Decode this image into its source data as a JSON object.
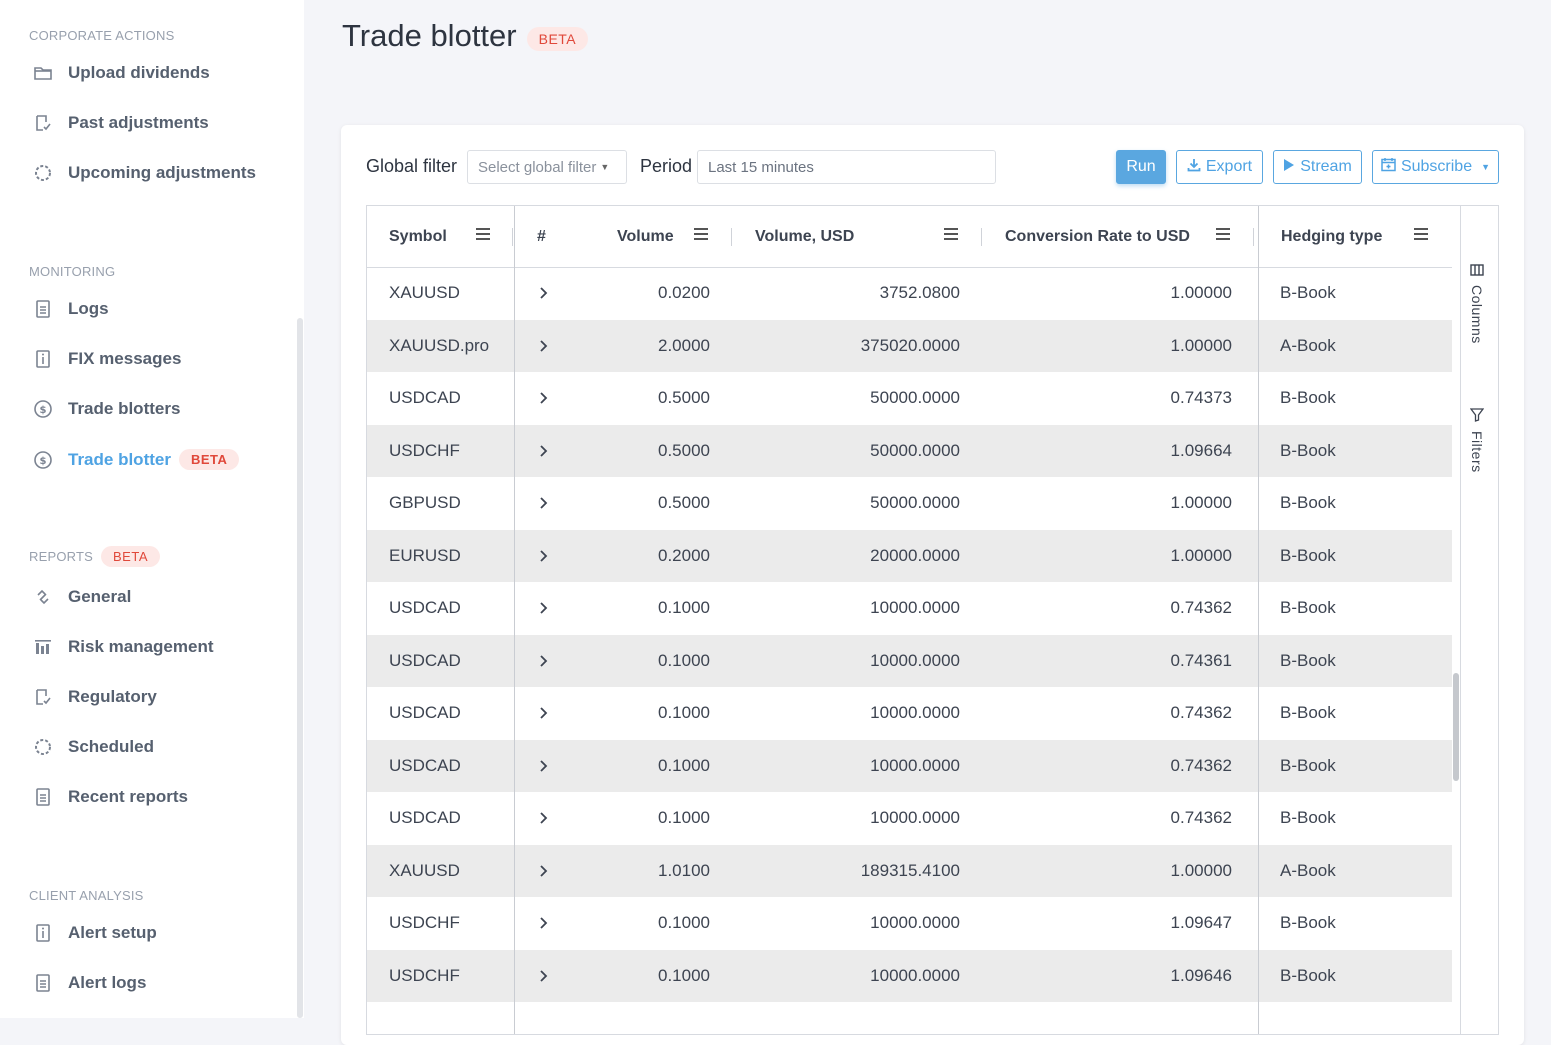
{
  "sidebar": {
    "sections": [
      {
        "title": "CORPORATE ACTIONS",
        "items": [
          {
            "label": "Upload dividends",
            "icon": "folder-icon"
          },
          {
            "label": "Past adjustments",
            "icon": "edit-check-icon"
          },
          {
            "label": "Upcoming adjustments",
            "icon": "loader-icon"
          }
        ]
      },
      {
        "title": "MONITORING",
        "items": [
          {
            "label": "Logs",
            "icon": "document-icon"
          },
          {
            "label": "FIX messages",
            "icon": "info-document-icon"
          },
          {
            "label": "Trade blotters",
            "icon": "dollar-circle-icon"
          },
          {
            "label": "Trade blotter",
            "icon": "dollar-circle-icon",
            "badge": "BETA",
            "active": true
          }
        ]
      },
      {
        "title": "REPORTS",
        "badge": "BETA",
        "items": [
          {
            "label": "General",
            "icon": "link-icon"
          },
          {
            "label": "Risk management",
            "icon": "bar-chart-icon"
          },
          {
            "label": "Regulatory",
            "icon": "edit-check-icon"
          },
          {
            "label": "Scheduled",
            "icon": "loader-icon"
          },
          {
            "label": "Recent reports",
            "icon": "document-icon"
          }
        ]
      },
      {
        "title": "CLIENT ANALYSIS",
        "items": [
          {
            "label": "Alert setup",
            "icon": "info-document-icon"
          },
          {
            "label": "Alert logs",
            "icon": "document-icon"
          }
        ]
      }
    ]
  },
  "page": {
    "title": "Trade blotter",
    "badge": "BETA"
  },
  "toolbar": {
    "global_filter_label": "Global filter",
    "global_filter_placeholder": "Select global filter",
    "period_label": "Period",
    "period_value": "Last 15 minutes",
    "run_label": "Run",
    "export_label": "Export",
    "stream_label": "Stream",
    "subscribe_label": "Subscribe"
  },
  "grid": {
    "columns": [
      "Symbol",
      "#",
      "Volume",
      "Volume, USD",
      "Conversion Rate to USD",
      "Hedging type"
    ],
    "side_tabs": [
      "Columns",
      "Filters"
    ],
    "rows": [
      {
        "symbol": "XAUUSD",
        "volume": "0.0200",
        "volume_usd": "3752.0800",
        "rate": "1.00000",
        "hedging": "B-Book"
      },
      {
        "symbol": "XAUUSD.pro",
        "volume": "2.0000",
        "volume_usd": "375020.0000",
        "rate": "1.00000",
        "hedging": "A-Book"
      },
      {
        "symbol": "USDCAD",
        "volume": "0.5000",
        "volume_usd": "50000.0000",
        "rate": "0.74373",
        "hedging": "B-Book"
      },
      {
        "symbol": "USDCHF",
        "volume": "0.5000",
        "volume_usd": "50000.0000",
        "rate": "1.09664",
        "hedging": "B-Book"
      },
      {
        "symbol": "GBPUSD",
        "volume": "0.5000",
        "volume_usd": "50000.0000",
        "rate": "1.00000",
        "hedging": "B-Book"
      },
      {
        "symbol": "EURUSD",
        "volume": "0.2000",
        "volume_usd": "20000.0000",
        "rate": "1.00000",
        "hedging": "B-Book"
      },
      {
        "symbol": "USDCAD",
        "volume": "0.1000",
        "volume_usd": "10000.0000",
        "rate": "0.74362",
        "hedging": "B-Book"
      },
      {
        "symbol": "USDCAD",
        "volume": "0.1000",
        "volume_usd": "10000.0000",
        "rate": "0.74361",
        "hedging": "B-Book"
      },
      {
        "symbol": "USDCAD",
        "volume": "0.1000",
        "volume_usd": "10000.0000",
        "rate": "0.74362",
        "hedging": "B-Book"
      },
      {
        "symbol": "USDCAD",
        "volume": "0.1000",
        "volume_usd": "10000.0000",
        "rate": "0.74362",
        "hedging": "B-Book"
      },
      {
        "symbol": "USDCAD",
        "volume": "0.1000",
        "volume_usd": "10000.0000",
        "rate": "0.74362",
        "hedging": "B-Book"
      },
      {
        "symbol": "XAUUSD",
        "volume": "1.0100",
        "volume_usd": "189315.4100",
        "rate": "1.00000",
        "hedging": "A-Book"
      },
      {
        "symbol": "USDCHF",
        "volume": "0.1000",
        "volume_usd": "10000.0000",
        "rate": "1.09647",
        "hedging": "B-Book"
      },
      {
        "symbol": "USDCHF",
        "volume": "0.1000",
        "volume_usd": "10000.0000",
        "rate": "1.09646",
        "hedging": "B-Book"
      }
    ]
  },
  "colors": {
    "accent": "#4fa3e3",
    "badge_bg": "#fde8e6",
    "badge_text": "#e0483a",
    "row_alt": "#ebebeb"
  }
}
